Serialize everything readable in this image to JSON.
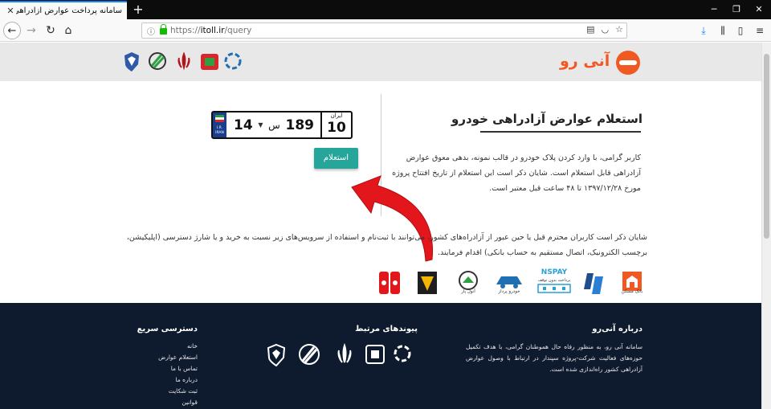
{
  "browser": {
    "tab_title": "سامانه پرداخت عوارض آزادراهی آنی رو",
    "new_tab_symbol": "+",
    "url_prefix": "https://",
    "url_host": "itoll.ir",
    "url_path": "/query"
  },
  "site": {
    "brand_name": "آنی رو"
  },
  "plate": {
    "region_label": "ایران",
    "region_number": "10",
    "number": "189",
    "letter": "س",
    "two_digit": "14",
    "flag_text": "I.R. IRAN"
  },
  "query": {
    "title": "استعلام عوارض آزادراهی خودرو",
    "intro": "کاربر گرامی، با وارد کردن پلاک خودرو در قالب نمونه، بدهی معوق عوارض آزادراهی قابل استعلام است. شایان ذکر است این استعلام از تاریخ افتتاح پروژه مورخ ۱۳۹۷/۱۲/۲۸ تا ۴۸ ساعت قبل معتبر است.",
    "button_label": "استعلام",
    "note": "شایان ذکر است کاربران محترم قبل یا حین عبور از آزادراه‌های کشور، می‌توانند با ثبت‌نام و استفاده از سرویس‌های زیر نسبت به خرید و یا شارژ دسترسی (اپلیکیشن، برچسب الکترونیک، اتصال مستقیم به حساب بانکی) اقدام فرمایند."
  },
  "services": {
    "nspay": "NSPAY",
    "nspay_sub": "پرداخت بدون توقف",
    "khodro": "خودرو پرداز",
    "anolpar": "آنول پار",
    "maskan": "بانک مسکن"
  },
  "footer": {
    "about_title": "درباره آنی‌رو",
    "about_text": "سامانه آنی رو، به منظور رفاه حال هموطنان گرامی، با هدف تکمیل حوزه‌های فعالیت شرکت-پروژه سپندار در ارتباط با وصول عوارض آزادراهی کشور راه‌اندازی شده است.",
    "links_title": "پیوندهای مرتبط",
    "quick_title": "دسترسی سریع",
    "quick_links": [
      "خانه",
      "استعلام عوارض",
      "تماس با ما",
      "درباره ما",
      "ثبت شکایت",
      "قوانین"
    ]
  },
  "colors": {
    "accent": "#26a59a",
    "brand": "#f05a22",
    "footer_bg": "#0e1b2e",
    "arrow": "#e3161c"
  }
}
